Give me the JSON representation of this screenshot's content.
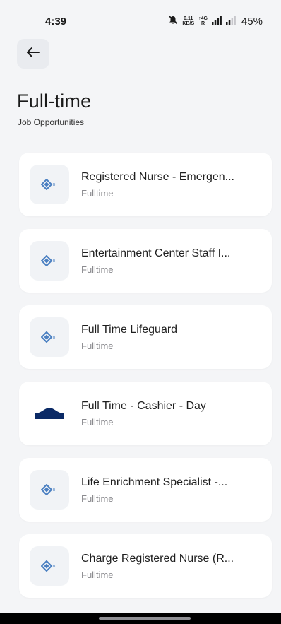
{
  "status_bar": {
    "time": "4:39",
    "net_speed_top": "0.11",
    "net_speed_bottom": "KB/S",
    "network_top": "↑4G",
    "network_bottom": "R",
    "battery": "45%",
    "icons": [
      "mute-bell-icon",
      "signal-icon",
      "signal-icon"
    ]
  },
  "header": {
    "back_icon": "arrow-left-icon",
    "title": "Full-time",
    "subtitle": "Job Opportunities"
  },
  "jobs": [
    {
      "title": "Registered Nurse - Emergen...",
      "type": "Fulltime",
      "logo": "company-diamond-logo"
    },
    {
      "title": "Entertainment Center Staff I...",
      "type": "Fulltime",
      "logo": "company-diamond-logo"
    },
    {
      "title": "Full Time Lifeguard",
      "type": "Fulltime",
      "logo": "company-diamond-logo"
    },
    {
      "title": "Full Time - Cashier - Day",
      "type": "Fulltime",
      "logo": "store-roof-logo"
    },
    {
      "title": "Life Enrichment Specialist -...",
      "type": "Fulltime",
      "logo": "company-diamond-logo"
    },
    {
      "title": "Charge Registered Nurse (R...",
      "type": "Fulltime",
      "logo": "company-diamond-logo"
    }
  ],
  "colors": {
    "background": "#f4f5f7",
    "card": "#ffffff",
    "logo_blue": "#4a7fc1",
    "store_navy": "#0b2a66",
    "secondary_text": "#8a8a8e"
  }
}
